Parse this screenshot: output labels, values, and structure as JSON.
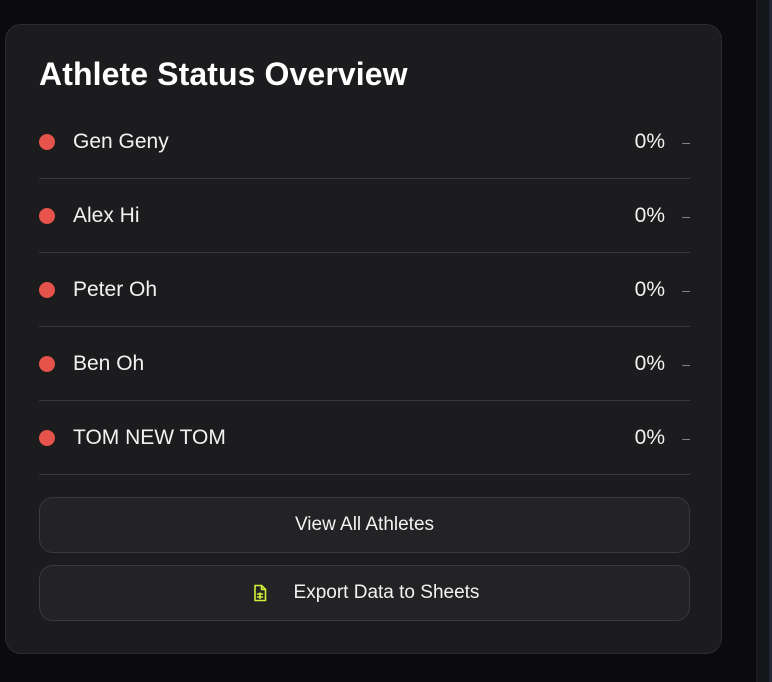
{
  "card": {
    "title": "Athlete Status Overview"
  },
  "athletes": [
    {
      "name": "Gen Geny",
      "percent": "0%",
      "trend": "–",
      "status_color": "#e5534b"
    },
    {
      "name": "Alex Hi",
      "percent": "0%",
      "trend": "–",
      "status_color": "#e5534b"
    },
    {
      "name": "Peter Oh",
      "percent": "0%",
      "trend": "–",
      "status_color": "#e5534b"
    },
    {
      "name": "Ben Oh",
      "percent": "0%",
      "trend": "–",
      "status_color": "#e5534b"
    },
    {
      "name": "TOM NEW TOM",
      "percent": "0%",
      "trend": "–",
      "status_color": "#e5534b"
    }
  ],
  "actions": {
    "view_all_label": "View All Athletes",
    "export_label": "Export Data to Sheets",
    "export_icon": "spreadsheet-icon",
    "export_icon_color": "#d4ef3a"
  }
}
